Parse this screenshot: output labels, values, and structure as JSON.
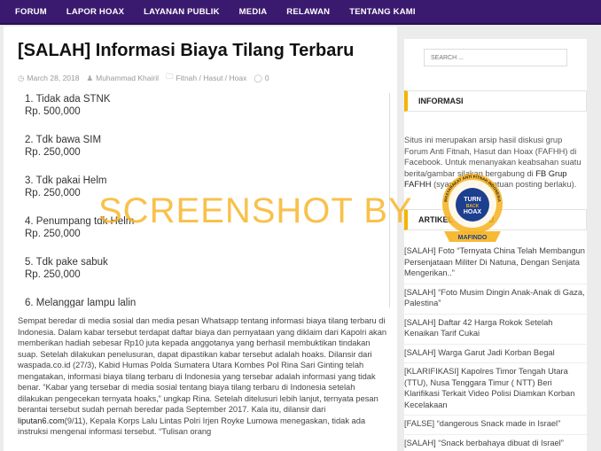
{
  "nav": {
    "items": [
      "FORUM",
      "LAPOR HOAX",
      "LAYANAN PUBLIK",
      "MEDIA",
      "RELAWAN",
      "TENTANG KAMI"
    ]
  },
  "article": {
    "title": "[SALAH] Informasi Biaya Tilang Terbaru",
    "date": "March 28, 2018",
    "author": "Muhammad Khairil",
    "categories": "Fitnah / Hasut / Hoax",
    "comments": "0",
    "tarif_items": [
      {
        "label": "1. Tidak ada STNK",
        "price": "Rp. 500,000"
      },
      {
        "label": "2. Tdk bawa SIM",
        "price": "Rp. 250,000"
      },
      {
        "label": "3. Tdk pakai Helm",
        "price": "Rp. 250,000"
      },
      {
        "label": "4. Penumpang tdk Helm",
        "price": "Rp. 250,000"
      },
      {
        "label": "5. Tdk pake sabuk",
        "price": "Rp. 250,000"
      },
      {
        "label": "6. Melanggar lampu lalin",
        "price": ""
      }
    ],
    "body_part1": "Sempat beredar di media sosial dan media pesan Whatsapp tentang informasi biaya tilang terbaru di Indonesia. Dalam kabar tersebut terdapat daftar biaya dan pernyataan yang diklaim dari Kapolri akan memberikan hadiah sebesar Rp10 juta kepada anggotanya yang berhasil membuktikan tindakan suap. Setelah dilakukan penelusuran, dapat dipastikan kabar tersebut adalah hoaks. Dilansir dari waspada.co.id (27/3), Kabid Humas Polda Sumatera Utara Kombes Pol Rina Sari Ginting telah mengatakan, informasi biaya tilang terbaru di Indonesia yang tersebar adalah informasi yang tidak benar. “Kabar yang tersebar di media sosial tentang biaya tilang terbaru di Indonesia setelah dilakukan pengecekan ternyata hoaks,” ungkap Rina. Setelah ditelusuri lebih lanjut, ternyata pesan berantai tersebut sudah pernah beredar pada September 2017. Kala itu, dilansir dari ",
    "body_link": "liputan6.com",
    "body_part2": "(9/11), Kepala Korps Lalu Lintas Polri Irjen Royke Lumowa menegaskan, tidak ada instruksi mengenai informasi tersebut. “Tulisan orang"
  },
  "sidebar": {
    "search_placeholder": "SEARCH ...",
    "info_heading": "INFORMASI",
    "info_text_a": "Situs ini merupakan arsip hasil diskusi grup Forum Anti Fitnah, Hasut dan Hoax (FAFHH) di Facebook. Untuk menanyakan keabsahan suatu berita/gambar silakan bergabung di ",
    "info_link": "FB Grup FAFHH",
    "info_text_b": " (syarat dan ketentuan posting berlaku).",
    "articles_heading": "ARTIKEL TERBARU",
    "articles": [
      "[SALAH] Foto “Ternyata China Telah Membangun Persenjataan Militer Di Natuna, Dengan Senjata Mengerikan..”",
      "[SALAH] “Foto Musim Dingin Anak-Anak di Gaza, Palestina”",
      "[SALAH] Daftar 42 Harga Rokok Setelah Kenaikan Tarif Cukai",
      "[SALAH] Warga Garut Jadi Korban Begal",
      "[KLARIFIKASI] Kapolres Timor Tengah Utara (TTU), Nusa Tenggara Timur ( NTT) Beri Klarifikasi Terkait Video Polisi Diamkan Korban Kecelakaan",
      "[FALSE] “dangerous Snack made in Israel”",
      "[SALAH] “Snack berbahaya dibuat di Israel”"
    ]
  },
  "watermark": {
    "text": "SCREENSHOT BY",
    "seal_top": "MASYARAKAT ANTI FITNAH INDONESIA",
    "seal_center_1": "TURN",
    "seal_center_2": "BACK",
    "seal_center_3": "HOAX",
    "seal_bottom": "MAFINDO"
  },
  "colors": {
    "nav_bg": "#3a1a6e",
    "accent": "#f4b400",
    "seal_blue": "#1d3f8f",
    "watermark": "#f6b21e"
  }
}
